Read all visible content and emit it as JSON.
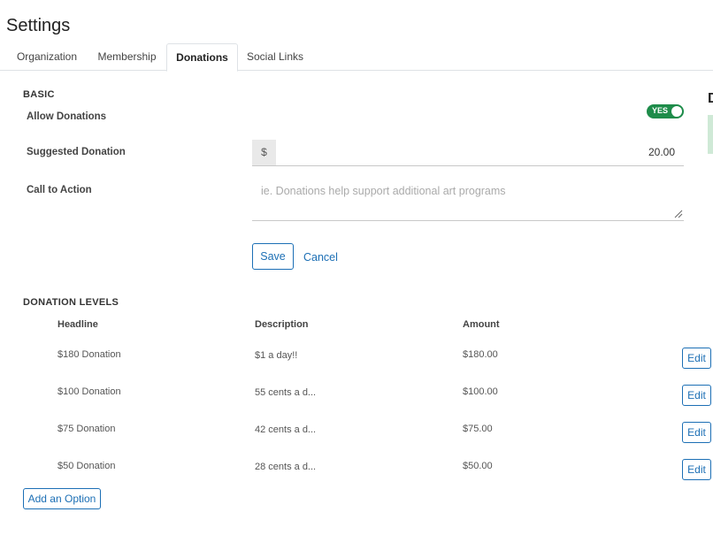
{
  "page": {
    "title": "Settings"
  },
  "tabs": [
    "Organization",
    "Membership",
    "Donations",
    "Social Links"
  ],
  "active_tab": "Donations",
  "basic": {
    "heading": "BASIC",
    "allow_donations_label": "Allow Donations",
    "toggle_text": "YES",
    "suggested_label": "Suggested Donation",
    "currency_symbol": "$",
    "suggested_value": "20.00",
    "cta_label": "Call to Action",
    "cta_placeholder": "ie. Donations help support additional art programs",
    "save_label": "Save",
    "cancel_label": "Cancel"
  },
  "levels": {
    "heading": "DONATION LEVELS",
    "columns": {
      "headline": "Headline",
      "description": "Description",
      "amount": "Amount"
    },
    "rows": [
      {
        "headline": "$180 Donation",
        "description": "$1 a day!!",
        "amount": "$180.00",
        "edit": "Edit"
      },
      {
        "headline": "$100 Donation",
        "description": "55 cents a d...",
        "amount": "$100.00",
        "edit": "Edit"
      },
      {
        "headline": "$75 Donation",
        "description": "42 cents a d...",
        "amount": "$75.00",
        "edit": "Edit"
      },
      {
        "headline": "$50 Donation",
        "description": "28 cents a d...",
        "amount": "$50.00",
        "edit": "Edit"
      }
    ],
    "add_label": "Add an Option"
  },
  "right_panel": {
    "letter": "D",
    "accent": "#cfe9d6"
  },
  "colors": {
    "primary": "#1c6fb5",
    "toggle_on": "#1e8c4a"
  }
}
